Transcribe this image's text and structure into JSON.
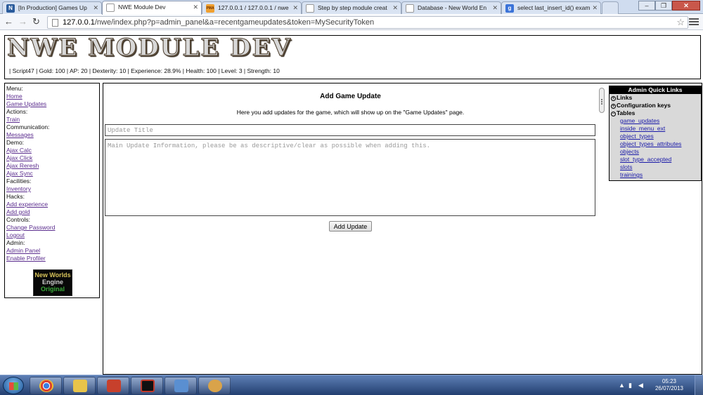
{
  "browser": {
    "tabs": [
      {
        "label": "[In Production] Games Up",
        "favicon": "N",
        "favicon_color": "#2a5b9b",
        "active": false
      },
      {
        "label": "NWE Module Dev",
        "favicon": "",
        "favicon_color": "#ffffff",
        "active": true
      },
      {
        "label": "127.0.0.1 / 127.0.0.1 / nwe",
        "favicon": "PMA",
        "favicon_color": "#f0a030",
        "active": false
      },
      {
        "label": "Step by step module creat",
        "favicon": "",
        "favicon_color": "#ffffff",
        "active": false
      },
      {
        "label": "Database - New World En",
        "favicon": "",
        "favicon_color": "#ffffff",
        "active": false
      },
      {
        "label": "select last_insert_id() exam",
        "favicon": "g",
        "favicon_color": "#3b73d8",
        "active": false
      }
    ],
    "url_host": "127.0.0.1",
    "url_path": "/nwe/index.php?p=admin_panel&a=recentgameupdates&token=MySecurityToken"
  },
  "header": {
    "logo": "NWE MODULE DEV",
    "stats": "|  Script47  |  Gold: 100  |  AP: 20  |  Dexterity: 10  |  Experience: 28.9%  |  Health: 100  |  Level: 3  |  Strength: 10"
  },
  "nav": {
    "menu_label": "Menu:",
    "home": "Home",
    "game_updates": "Game Updates",
    "actions_label": "Actions:",
    "train": "Train",
    "communication_label": "Communication:",
    "messages": "Messages",
    "demo_label": "Demo:",
    "ajax_calc": "Ajax Calc",
    "ajax_click": "Ajax Click",
    "ajax_reresh": "Ajax Reresh",
    "ajax_sync": "Ajax Sync",
    "facilities_label": "Facilities:",
    "inventory": "Inventory",
    "hacks_label": "Hacks:",
    "add_experience": "Add experience",
    "add_gold": "Add gold",
    "controls_label": "Controls:",
    "change_password": "Change Password",
    "logout": "Logout",
    "admin_label": "Admin:",
    "admin_panel": "Admin Panel",
    "enable_profiler": "Enable Profiler",
    "badge_line1": "New Worlds",
    "badge_line2": "Engine",
    "badge_line3": "Original"
  },
  "main": {
    "title": "Add Game Update",
    "description": "Here you add updates for the game, which will show up on the \"Game Updates\" page.",
    "title_placeholder": "Update Title",
    "body_placeholder": "Main Update Information, please be as descriptive/clear as possible when adding this.",
    "submit_label": "Add Update"
  },
  "quick_links": {
    "title": "Admin Quick Links",
    "links_label": "Links",
    "config_label": "Configuration keys",
    "tables_label": "Tables",
    "expanded_toggle": "−",
    "collapsed_toggle": "+",
    "tables": [
      "game_updates",
      "inside_menu_ext",
      "object_types",
      "object_types_attributes",
      "objects",
      "slot_type_accepted",
      "slots",
      "trainings"
    ]
  },
  "taskbar": {
    "time": "05:23",
    "date": "26/07/2013",
    "apps": [
      {
        "name": "chrome-app",
        "color": "#4a9e3c"
      },
      {
        "name": "explorer-app",
        "color": "#e8c44a"
      },
      {
        "name": "ccleaner-app",
        "color": "#c7402c"
      },
      {
        "name": "terminal-app",
        "color": "#111111"
      },
      {
        "name": "virtualbox-app",
        "color": "#5a8fd1"
      },
      {
        "name": "paint-app",
        "color": "#d9a34a"
      }
    ]
  }
}
